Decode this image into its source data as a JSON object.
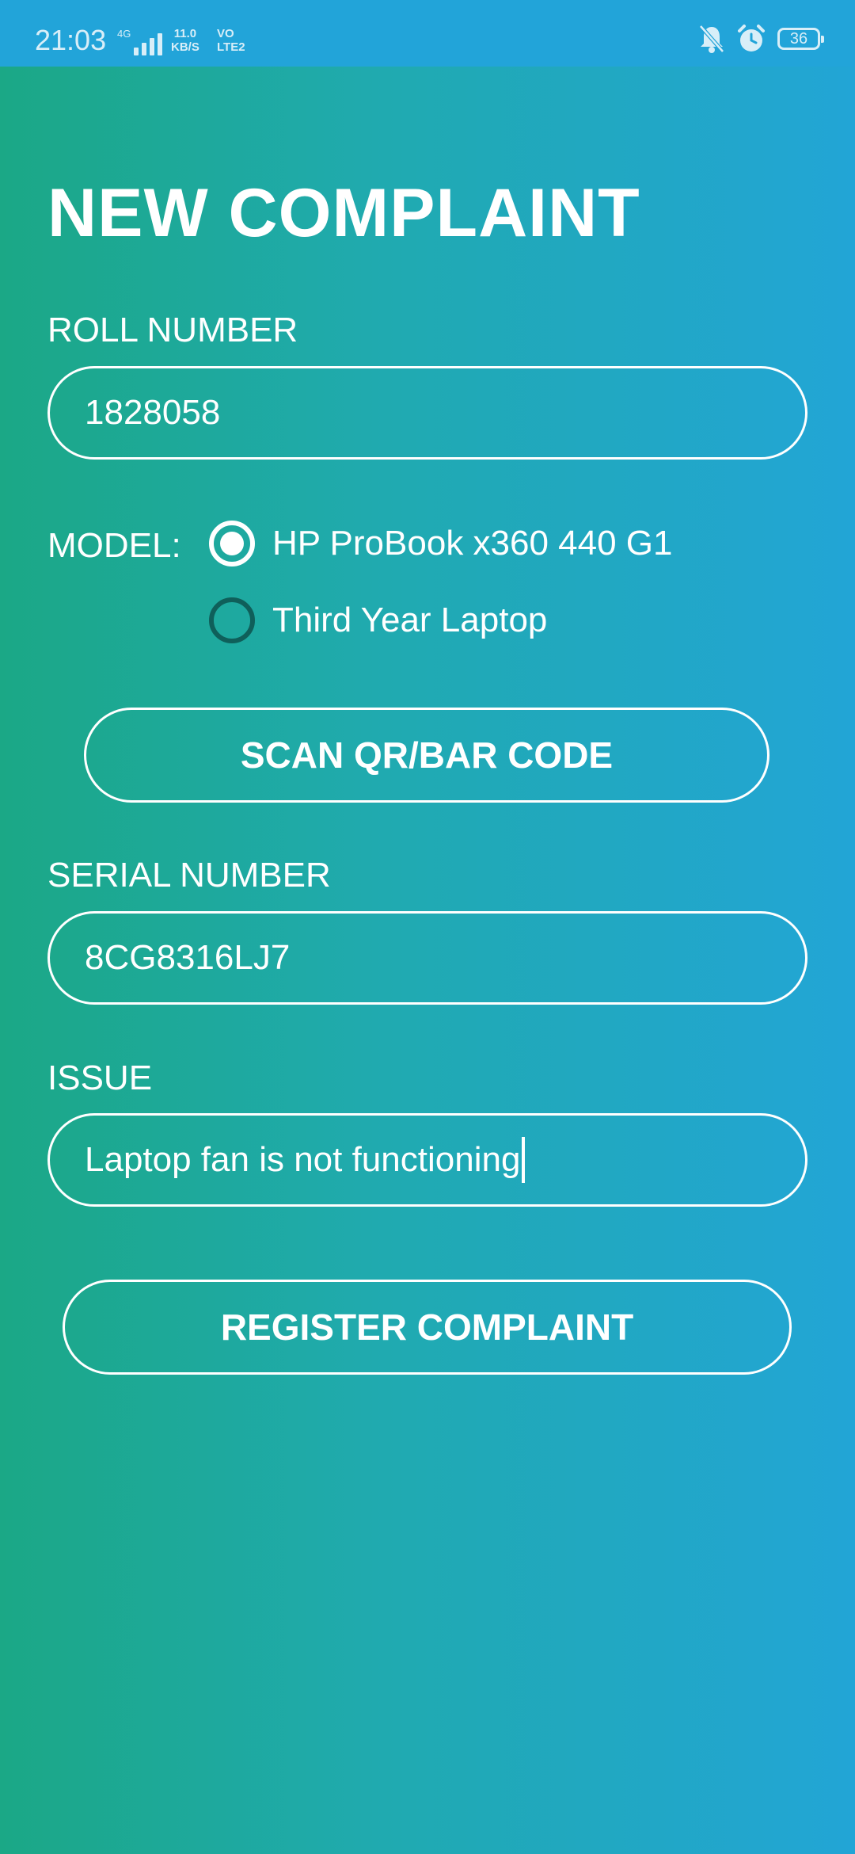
{
  "status_bar": {
    "time": "21:03",
    "network": "4G",
    "speed_value": "11.0",
    "speed_unit": "KB/S",
    "volte_top": "VO",
    "volte_bottom": "LTE2",
    "battery": "36"
  },
  "form": {
    "title": "NEW COMPLAINT",
    "roll_label": "ROLL NUMBER",
    "roll_value": "1828058",
    "model_label": "MODEL:",
    "model_options": [
      {
        "label": "HP ProBook x360 440 G1",
        "selected": true
      },
      {
        "label": "Third Year Laptop",
        "selected": false
      }
    ],
    "scan_button": "SCAN QR/BAR CODE",
    "serial_label": "SERIAL NUMBER",
    "serial_value": "8CG8316LJ7",
    "issue_label": "ISSUE",
    "issue_value": "Laptop fan is not functioning",
    "register_button": "REGISTER COMPLAINT"
  }
}
